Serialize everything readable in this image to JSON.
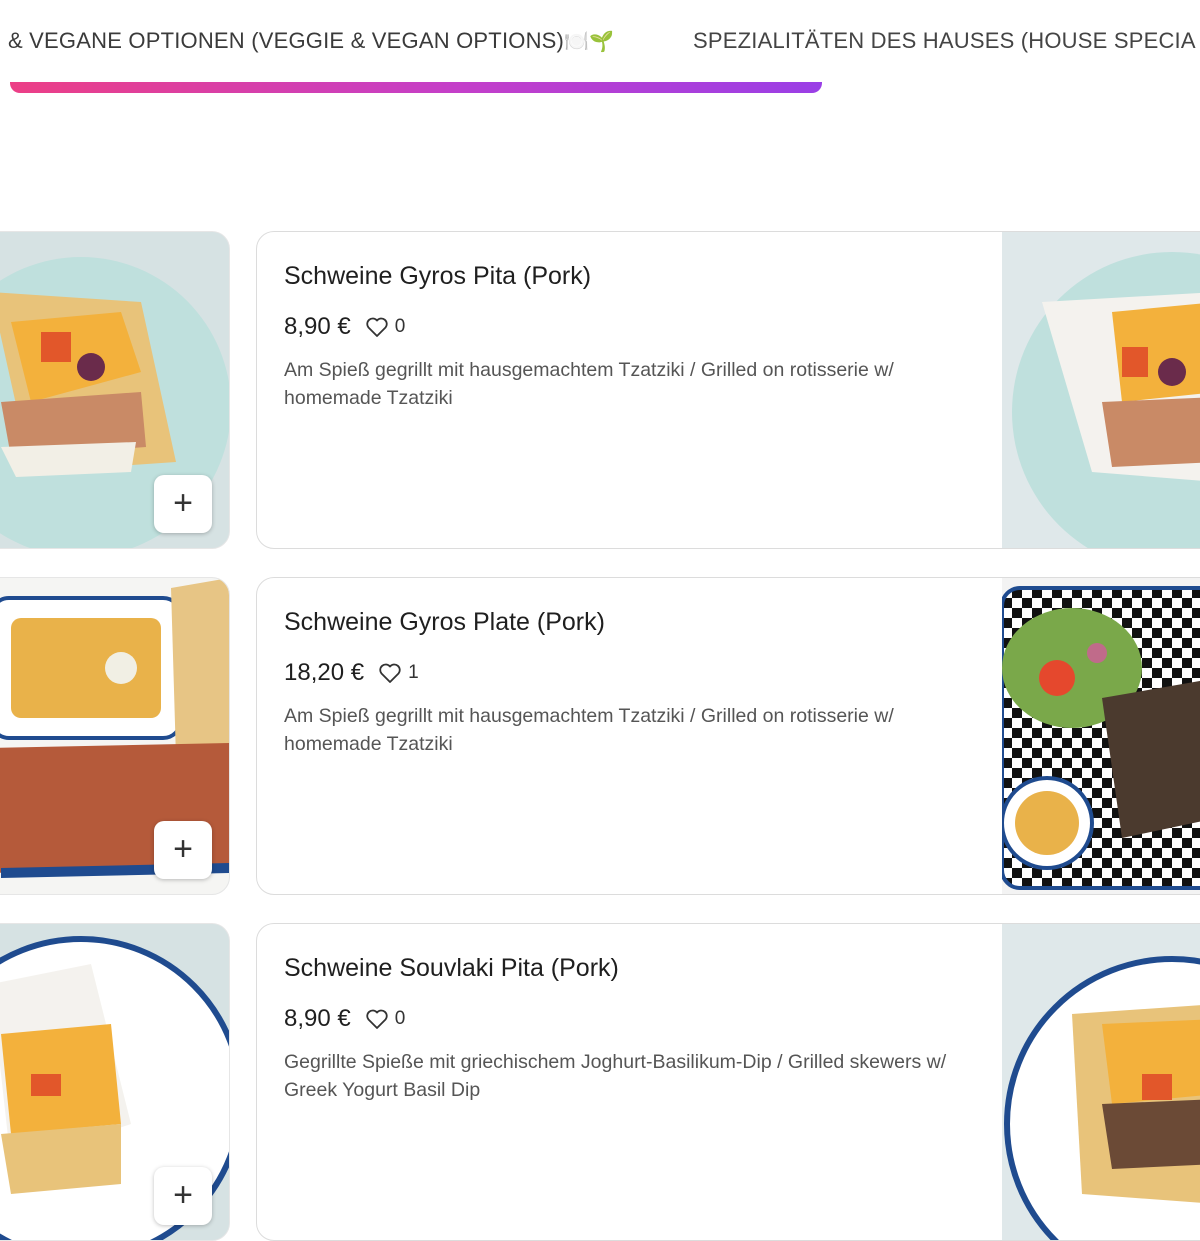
{
  "tabs": {
    "veggie": {
      "label": "& VEGANE OPTIONEN (VEGGIE & VEGAN OPTIONS)",
      "emoji": "🍽️🌱"
    },
    "house": {
      "label": "SPEZIALITÄTEN DES HAUSES (HOUSE SPECIA"
    }
  },
  "items": [
    {
      "title": "Schweine Gyros Pita (Pork)",
      "price": "8,90 €",
      "likes": "0",
      "description": "Am Spieß gegrillt mit hausgemachtem Tzatziki / Grilled on rotisserie w/ homemade Tzatziki",
      "add_label": "+"
    },
    {
      "title": "Schweine Gyros Plate (Pork)",
      "price": "18,20 €",
      "likes": "1",
      "description": "Am Spieß gegrillt mit hausgemachtem Tzatziki / Grilled on rotisserie w/ homemade Tzatziki",
      "add_label": "+"
    },
    {
      "title": "Schweine Souvlaki Pita (Pork)",
      "price": "8,90 €",
      "likes": "0",
      "description": "Gegrillte Spieße mit griechischem Joghurt-Basilikum-Dip / Grilled skewers w/ Greek Yogurt Basil Dip",
      "add_label": "+"
    }
  ],
  "colors": {
    "accent_start": "#ec3f86",
    "accent_end": "#9a3fe6"
  }
}
